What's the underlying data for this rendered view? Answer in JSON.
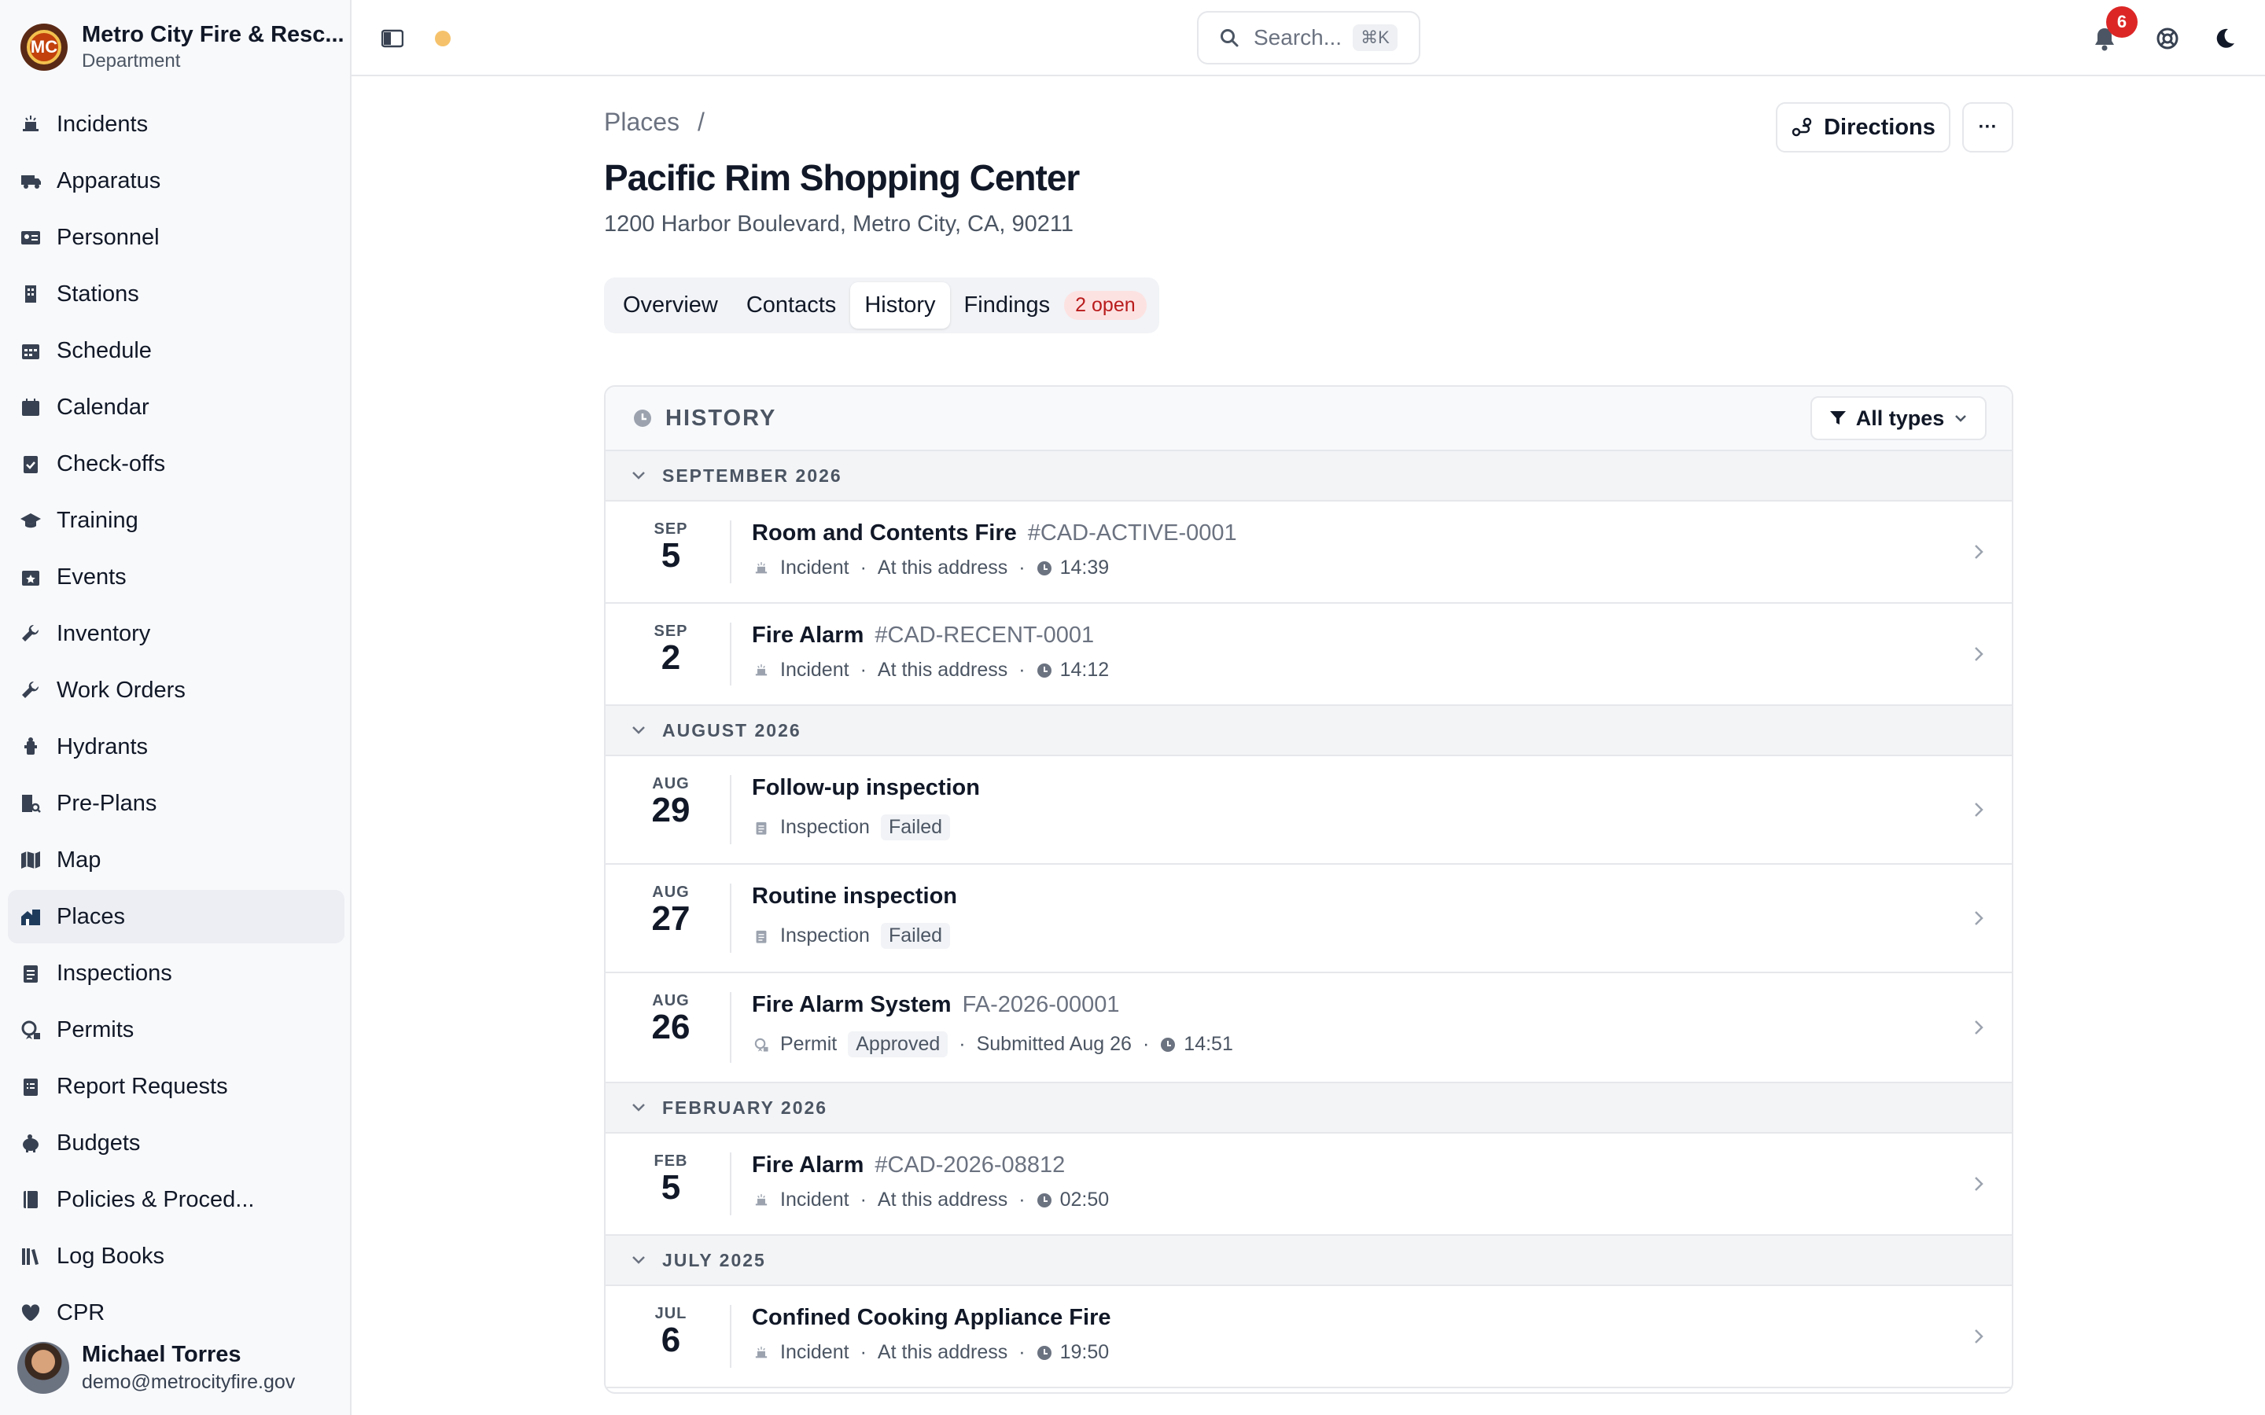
{
  "org": {
    "name": "Metro City Fire & Resc...",
    "sub": "Department",
    "logo_text": "MC"
  },
  "nav": [
    {
      "label": "Incidents",
      "icon": "incident-icon"
    },
    {
      "label": "Apparatus",
      "icon": "truck-icon"
    },
    {
      "label": "Personnel",
      "icon": "id-card-icon"
    },
    {
      "label": "Stations",
      "icon": "building-icon"
    },
    {
      "label": "Schedule",
      "icon": "schedule-icon"
    },
    {
      "label": "Calendar",
      "icon": "calendar-icon"
    },
    {
      "label": "Check-offs",
      "icon": "clipboard-check-icon"
    },
    {
      "label": "Training",
      "icon": "graduation-cap-icon"
    },
    {
      "label": "Events",
      "icon": "calendar-star-icon"
    },
    {
      "label": "Inventory",
      "icon": "wrench-icon"
    },
    {
      "label": "Work Orders",
      "icon": "wrench-icon"
    },
    {
      "label": "Hydrants",
      "icon": "hydrant-icon"
    },
    {
      "label": "Pre-Plans",
      "icon": "building-search-icon"
    },
    {
      "label": "Map",
      "icon": "map-icon"
    },
    {
      "label": "Places",
      "icon": "house-building-icon"
    },
    {
      "label": "Inspections",
      "icon": "clipboard-icon"
    },
    {
      "label": "Permits",
      "icon": "stamp-icon"
    },
    {
      "label": "Report Requests",
      "icon": "clipboard-list-icon"
    },
    {
      "label": "Budgets",
      "icon": "piggy-bank-icon"
    },
    {
      "label": "Policies & Proced...",
      "icon": "book-icon"
    },
    {
      "label": "Log Books",
      "icon": "books-icon"
    },
    {
      "label": "CPR",
      "icon": "heart-icon"
    }
  ],
  "user": {
    "name": "Michael Torres",
    "email": "demo@metrocityfire.gov"
  },
  "search": {
    "placeholder": "Search...",
    "shortcut": "⌘K"
  },
  "notifications": {
    "count": "6"
  },
  "colors": {
    "accent": "#dc2626",
    "status_dot": "#f5c26b",
    "danger_pill_bg": "#fde2e2"
  },
  "page": {
    "breadcrumb": "Places",
    "breadcrumb_sep": "/",
    "title": "Pacific Rim Shopping Center",
    "address": "1200 Harbor Boulevard, Metro City, CA, 90211",
    "directions_label": "Directions",
    "more_label": "···"
  },
  "tabs": [
    {
      "label": "Overview",
      "active": false
    },
    {
      "label": "Contacts",
      "active": false
    },
    {
      "label": "History",
      "active": true
    },
    {
      "label": "Findings",
      "active": false
    }
  ],
  "findings_badge": "2 open",
  "history": {
    "title": "HISTORY",
    "filter_label": "All types",
    "groups": [
      {
        "label": "SEPTEMBER 2026",
        "entries": [
          {
            "month": "SEP",
            "day": "5",
            "title": "Room and Contents Fire",
            "ref": "#CAD-ACTIVE-0001",
            "type": "Incident",
            "type_icon": "incident-icon",
            "location": "At this address",
            "time": "14:39"
          },
          {
            "month": "SEP",
            "day": "2",
            "title": "Fire Alarm",
            "ref": "#CAD-RECENT-0001",
            "type": "Incident",
            "type_icon": "incident-icon",
            "location": "At this address",
            "time": "14:12"
          }
        ]
      },
      {
        "label": "AUGUST 2026",
        "entries": [
          {
            "month": "AUG",
            "day": "29",
            "title": "Follow-up inspection",
            "type": "Inspection",
            "type_icon": "clipboard-icon",
            "status": "Failed"
          },
          {
            "month": "AUG",
            "day": "27",
            "title": "Routine inspection",
            "type": "Inspection",
            "type_icon": "clipboard-icon",
            "status": "Failed"
          },
          {
            "month": "AUG",
            "day": "26",
            "title": "Fire Alarm System",
            "ref": "FA-2026-00001",
            "type": "Permit",
            "type_icon": "stamp-icon",
            "status": "Approved",
            "submitted": "Submitted Aug 26",
            "time": "14:51"
          }
        ]
      },
      {
        "label": "FEBRUARY 2026",
        "entries": [
          {
            "month": "FEB",
            "day": "5",
            "title": "Fire Alarm",
            "ref": "#CAD-2026-08812",
            "type": "Incident",
            "type_icon": "incident-icon",
            "location": "At this address",
            "time": "02:50"
          }
        ]
      },
      {
        "label": "JULY 2025",
        "entries": [
          {
            "month": "JUL",
            "day": "6",
            "title": "Confined Cooking Appliance Fire",
            "type": "Incident",
            "type_icon": "incident-icon",
            "location": "At this address",
            "time": "19:50"
          }
        ]
      }
    ]
  }
}
